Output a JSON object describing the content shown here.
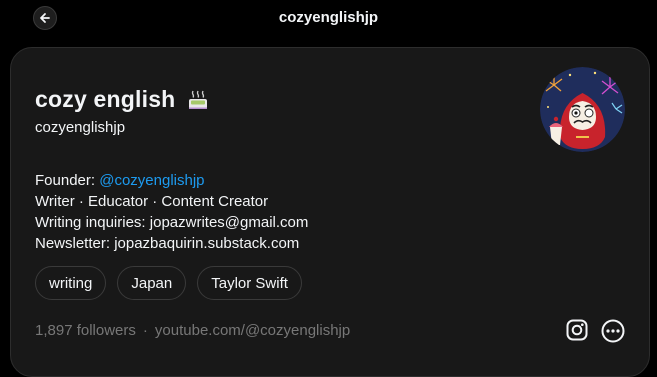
{
  "header": {
    "title": "cozyenglishjp",
    "back_icon": "arrow-left-icon"
  },
  "profile": {
    "display_name": "cozy english",
    "name_emoji_icon": "hot-beverage-icon",
    "handle": "cozyenglishjp",
    "avatar_icon": "daruma-avatar"
  },
  "bio": {
    "founder_prefix": "Founder: ",
    "founder_mention": "@cozyenglishjp",
    "line2": "Writer · Educator · Content Creator",
    "line3": "Writing inquiries: jopazwrites@gmail.com",
    "line4": "Newsletter: jopazbaquirin.substack.com"
  },
  "tags": [
    "writing",
    "Japan",
    "Taylor Swift"
  ],
  "footer": {
    "followers": "1,897 followers",
    "separator": "·",
    "link": "youtube.com/@cozyenglishjp",
    "instagram_icon": "instagram-icon",
    "more_icon": "more-options-icon"
  },
  "colors": {
    "background": "#000000",
    "card": "#181818",
    "mention": "#1d9bf0",
    "muted": "#777777"
  }
}
